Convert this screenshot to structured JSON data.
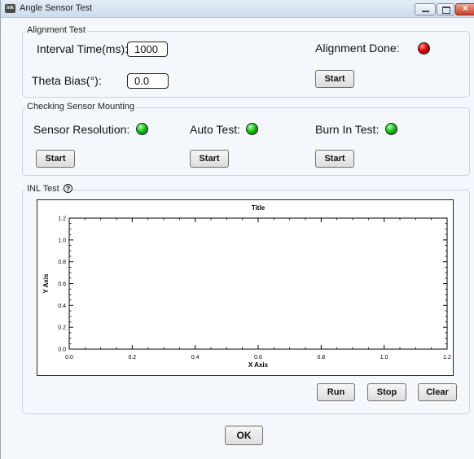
{
  "window": {
    "title": "Angle Sensor Test",
    "icon_text": "ink"
  },
  "alignment": {
    "group_title": "Alignment Test",
    "interval_label": "Interval Time(ms):",
    "interval_value": "1000",
    "theta_label": "Theta Bias(°):",
    "theta_value": "0.0",
    "done_label": "Alignment Done:",
    "done_status": "red",
    "start_label": "Start"
  },
  "mounting": {
    "group_title": "Checking Sensor Mounting",
    "items": [
      {
        "label": "Sensor Resolution:",
        "status": "green",
        "button": "Start"
      },
      {
        "label": "Auto Test:",
        "status": "green",
        "button": "Start"
      },
      {
        "label": "Burn In Test:",
        "status": "green",
        "button": "Start"
      }
    ]
  },
  "inl": {
    "group_title": "INL Test",
    "help_icon": "question-circle-icon",
    "buttons": {
      "run": "Run",
      "stop": "Stop",
      "clear": "Clear"
    }
  },
  "chart_data": {
    "type": "line",
    "title": "Title",
    "xlabel": "X Axis",
    "ylabel": "Y Axis",
    "xlim": [
      0.0,
      1.2
    ],
    "ylim": [
      0.0,
      1.2
    ],
    "x_ticks": [
      "0.0",
      "0.2",
      "0.4",
      "0.6",
      "0.8",
      "1.0",
      "1.2"
    ],
    "y_ticks": [
      "0.0",
      "0.2",
      "0.4",
      "0.6",
      "0.8",
      "1.0",
      "1.2"
    ],
    "series": [],
    "grid": false
  },
  "footer": {
    "ok_label": "OK"
  },
  "colors": {
    "led_green": "#17c417",
    "led_red": "#e00000",
    "panel_bg": "#f4f8fc"
  }
}
